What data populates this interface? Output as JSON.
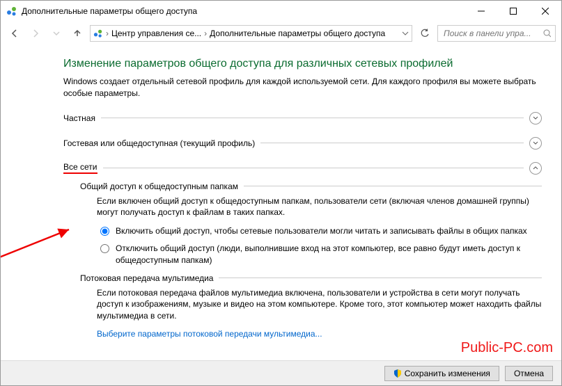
{
  "window": {
    "title": "Дополнительные параметры общего доступа"
  },
  "breadcrumb": {
    "item1": "Центр управления се...",
    "item2": "Дополнительные параметры общего доступа"
  },
  "search": {
    "placeholder": "Поиск в панели упра..."
  },
  "heading": "Изменение параметров общего доступа для различных сетевых профилей",
  "description": "Windows создает отдельный сетевой профиль для каждой используемой сети. Для каждого профиля вы можете выбрать особые параметры.",
  "sections": {
    "private": {
      "label": "Частная"
    },
    "guest": {
      "label": "Гостевая или общедоступная (текущий профиль)"
    },
    "all": {
      "label": "Все сети"
    }
  },
  "public_folder": {
    "group_label": "Общий доступ к общедоступным папкам",
    "desc": "Если включен общий доступ к общедоступным папкам, пользователи сети (включая членов домашней группы) могут получать доступ к файлам в таких папках.",
    "radio_on": "Включить общий доступ, чтобы сетевые пользователи могли читать и записывать файлы в общих папках",
    "radio_off": "Отключить общий доступ (люди, выполнившие вход на этот компьютер, все равно будут иметь доступ к общедоступным папкам)"
  },
  "media": {
    "group_label": "Потоковая передача мультимедиа",
    "desc": "Если потоковая передача файлов мультимедиа включена, пользователи и устройства в сети могут получать доступ к изображениям, музыке и видео на этом компьютере. Кроме того, этот компьютер может находить файлы мультимедиа в сети.",
    "link": "Выберите параметры потоковой передачи мультимедиа..."
  },
  "footer": {
    "save": "Сохранить изменения",
    "cancel": "Отмена"
  },
  "watermark": "Public-PC.com"
}
